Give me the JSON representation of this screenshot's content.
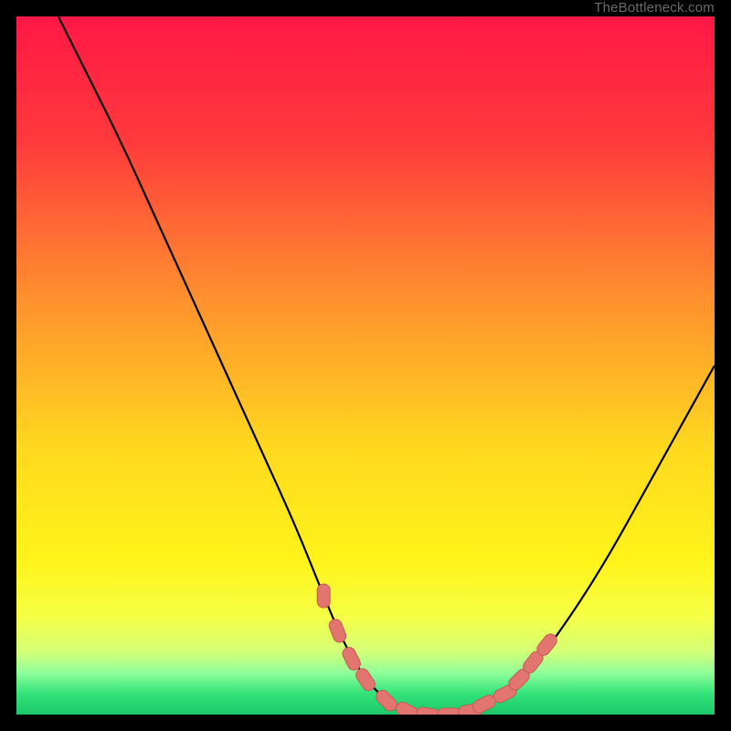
{
  "watermark": "TheBottleneck.com",
  "colors": {
    "frame": "#000000",
    "gradient_stops": [
      {
        "pct": 0,
        "color": "#ff1846"
      },
      {
        "pct": 18,
        "color": "#ff3a3c"
      },
      {
        "pct": 40,
        "color": "#ff8f2e"
      },
      {
        "pct": 62,
        "color": "#ffd91e"
      },
      {
        "pct": 78,
        "color": "#fff31a"
      },
      {
        "pct": 86,
        "color": "#f5ff45"
      },
      {
        "pct": 91,
        "color": "#d3ff77"
      },
      {
        "pct": 94,
        "color": "#8fff9a"
      },
      {
        "pct": 97,
        "color": "#34e27a"
      },
      {
        "pct": 100,
        "color": "#1bc76a"
      }
    ],
    "curve": "#000000",
    "marker_fill": "#e2756f",
    "marker_stroke": "#c45a55"
  },
  "chart_data": {
    "type": "line",
    "title": "",
    "xlabel": "",
    "ylabel": "",
    "xlim": [
      0,
      100
    ],
    "ylim": [
      0,
      100
    ],
    "grid": false,
    "legend": false,
    "series": [
      {
        "name": "bottleneck-curve",
        "x": [
          6,
          10,
          15,
          20,
          25,
          30,
          35,
          40,
          44,
          47,
          50,
          53,
          56,
          59,
          62,
          65,
          70,
          75,
          80,
          85,
          90,
          95,
          100
        ],
        "y": [
          100,
          92,
          82,
          71,
          60,
          49,
          38,
          27,
          17,
          10,
          5,
          2,
          0.5,
          0,
          0,
          0.5,
          3,
          8,
          15,
          23,
          32,
          41,
          50
        ]
      }
    ],
    "markers": {
      "name": "highlight-band",
      "x": [
        44,
        46,
        48,
        50,
        53,
        56,
        59,
        62,
        65,
        67,
        70,
        72,
        74,
        76
      ],
      "y": [
        17,
        12,
        8,
        5,
        2,
        0.5,
        0,
        0,
        0.5,
        1.5,
        3,
        5,
        7.5,
        10
      ]
    }
  }
}
